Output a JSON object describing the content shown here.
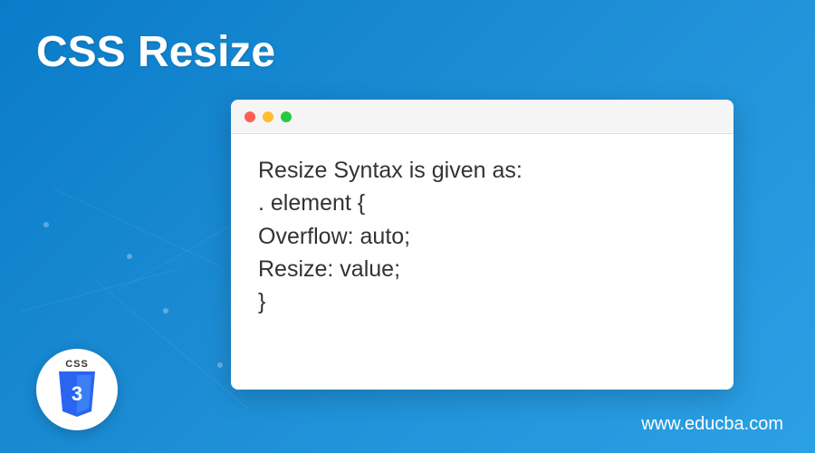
{
  "title": "CSS Resize",
  "code": {
    "line1": "Resize Syntax is given as:",
    "line2": ". element {",
    "line3": "Overflow: auto;",
    "line4": "Resize: value;",
    "line5": "}"
  },
  "logo": {
    "label": "CSS",
    "shield_number": "3"
  },
  "footer": {
    "url": "www.educba.com"
  },
  "colors": {
    "bg_gradient_start": "#0a7bc8",
    "bg_gradient_end": "#2ba0e5",
    "dot_red": "#ff5f56",
    "dot_yellow": "#ffbd2e",
    "dot_green": "#27c93f",
    "shield_blue": "#2965f1"
  }
}
